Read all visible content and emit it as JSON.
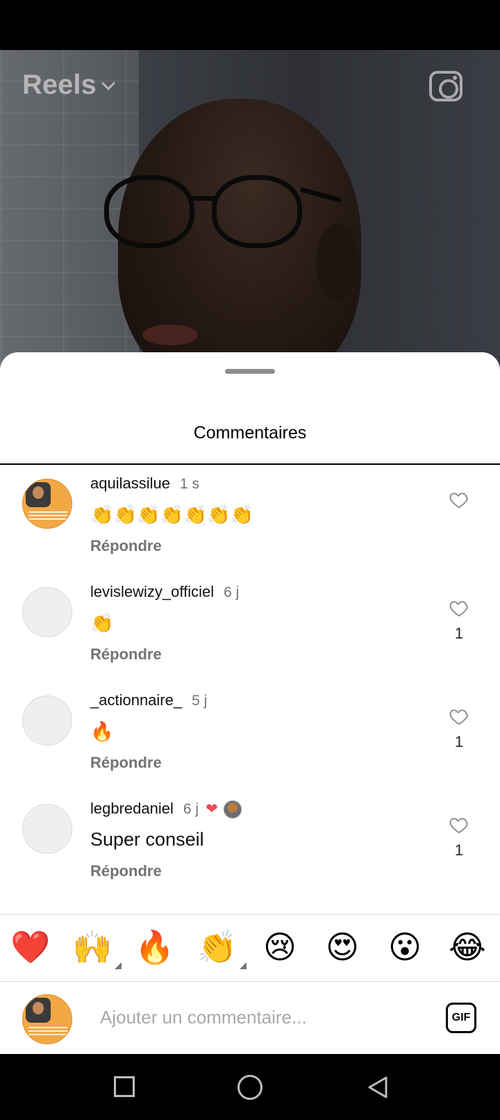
{
  "header": {
    "title": "Reels",
    "title_chevron_icon": "chevron-down-icon",
    "camera_icon": "camera-icon"
  },
  "comments_sheet": {
    "title": "Commentaires"
  },
  "comments": [
    {
      "username": "aquilassilue",
      "time": "1 s",
      "text": "👏👏👏👏👏👏👏",
      "reply_label": "Répondre",
      "likes": "",
      "avatar": "photo"
    },
    {
      "username": "levislewizy_officiel",
      "time": "6 j",
      "text": "👏",
      "reply_label": "Répondre",
      "likes": "1",
      "avatar": "blank"
    },
    {
      "username": "_actionnaire_",
      "time": "5 j",
      "text": "🔥",
      "reply_label": "Répondre",
      "likes": "1",
      "avatar": "blank"
    },
    {
      "username": "legbredaniel",
      "time": "6 j",
      "text": "Super conseil",
      "reply_label": "Répondre",
      "likes": "1",
      "avatar": "blank",
      "liked_by_author": true
    }
  ],
  "emoji_bar": [
    "❤️",
    "🙌",
    "🔥",
    "👏",
    "😢",
    "😍",
    "😮",
    "😂"
  ],
  "composer": {
    "placeholder": "Ajouter un commentaire...",
    "gif_label": "GIF"
  },
  "colors": {
    "like_red": "#ed4956",
    "secondary_text": "#737373",
    "avatar_orange": "#f3a846"
  }
}
